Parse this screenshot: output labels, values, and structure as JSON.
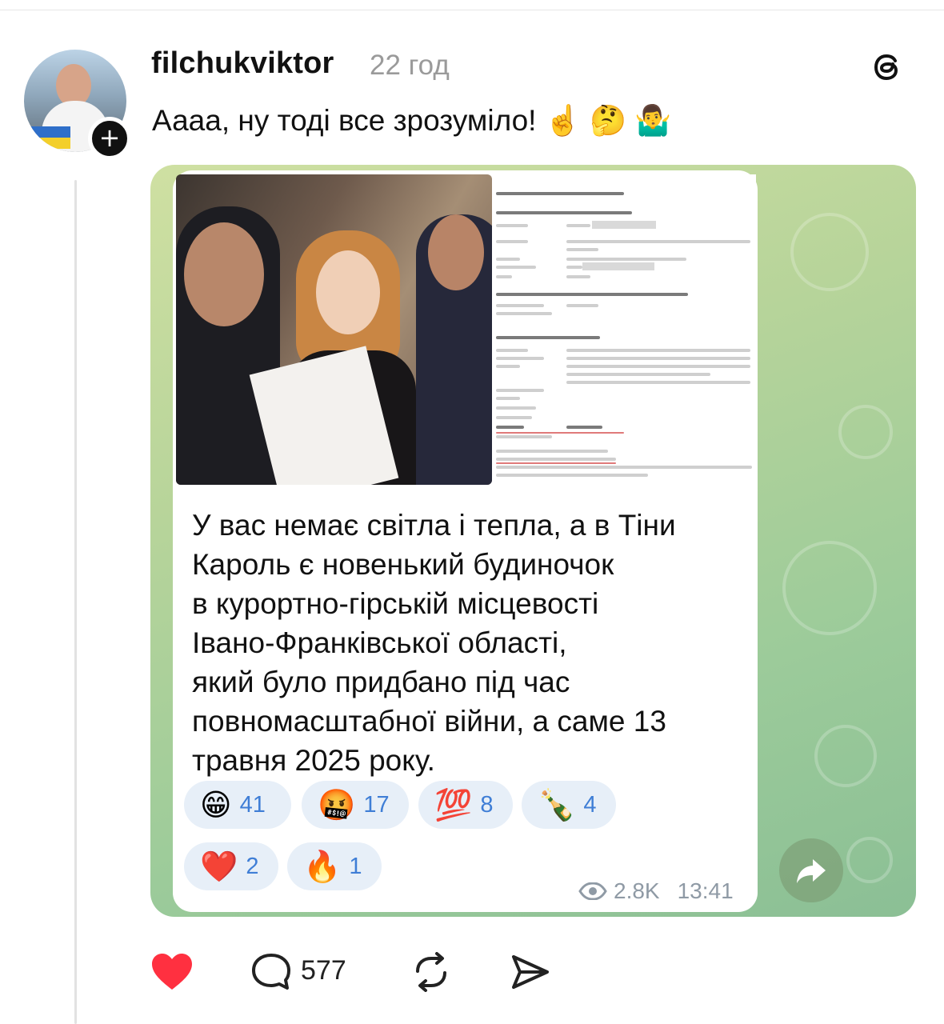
{
  "post": {
    "username": "filchukviktor",
    "time": "22 год",
    "text": "Аааа, ну тоді все зрозуміло! ☝️ 🤔 🤷‍♂️"
  },
  "telegram_card": {
    "caption_lines": [
      "У вас немає світла і тепла, а в Тіни",
      "Кароль є новенький будиночок",
      "в курортно-гірській місцевості",
      "Івано-Франківської області,",
      "який було придбано під час",
      "повномасштабної війни, а саме 13",
      "травня 2025 року."
    ],
    "reactions": [
      {
        "emoji": "😁",
        "count": "41"
      },
      {
        "emoji": "🤬",
        "count": "17"
      },
      {
        "emoji": "💯",
        "count": "8"
      },
      {
        "emoji": "🍾",
        "count": "4"
      },
      {
        "emoji": "❤️",
        "count": "2"
      },
      {
        "emoji": "🔥",
        "count": "1"
      }
    ],
    "views": "2.8K",
    "time": "13:41"
  },
  "actions": {
    "replies_count": "577"
  },
  "icons": {
    "like": "heart-icon",
    "reply": "comment-icon",
    "repost": "repost-icon",
    "share": "send-icon",
    "brand": "threads-icon"
  },
  "colors": {
    "like_red": "#ff3040",
    "reaction_bg": "#e7eff8",
    "reaction_count": "#3f7ed6"
  }
}
